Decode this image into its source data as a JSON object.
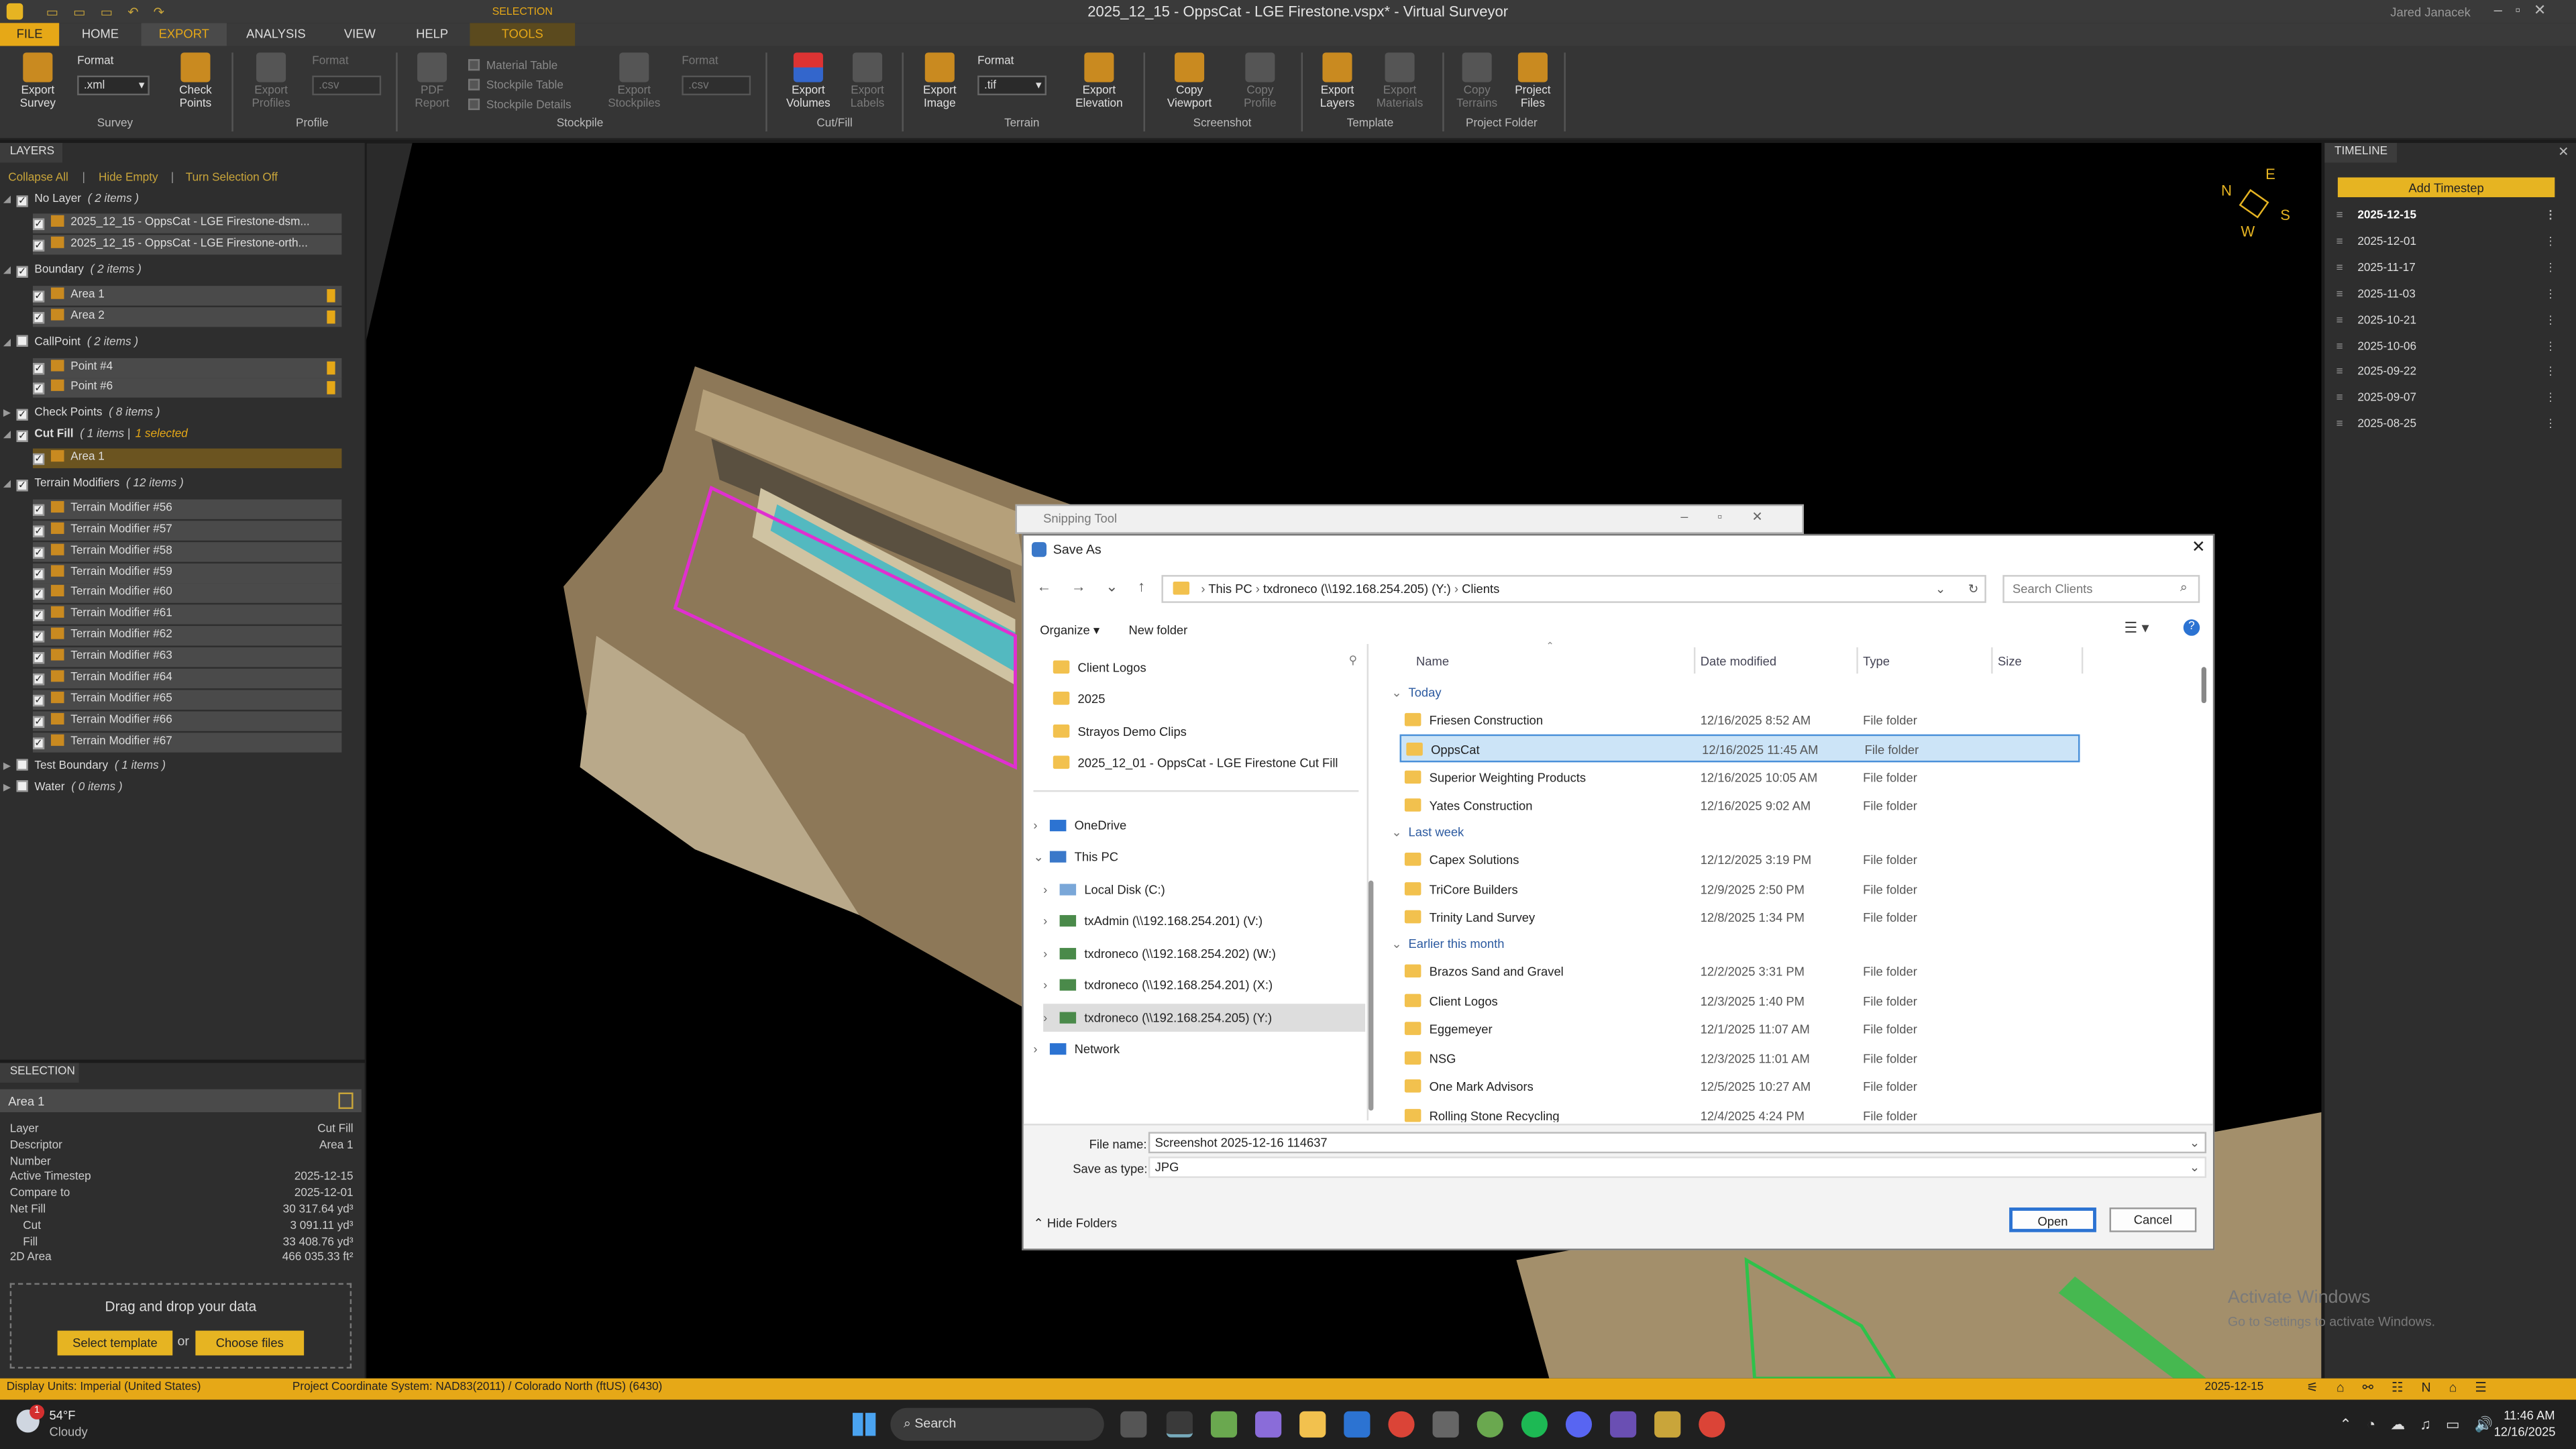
{
  "app": {
    "title": "2025_12_15 - OppsCat - LGE Firestone.vspx* - Virtual Surveyor",
    "user": "Jared Janacek",
    "selection_context": "SELECTION",
    "tools_tab": "TOOLS"
  },
  "tabs": [
    "FILE",
    "HOME",
    "EXPORT",
    "ANALYSIS",
    "VIEW",
    "HELP"
  ],
  "ribbon": {
    "survey": {
      "export_survey": "Export Survey",
      "format_label": "Format",
      "format_value": ".xml",
      "check_points": "Check Points",
      "group": "Survey"
    },
    "profile": {
      "export_profiles": "Export Profiles",
      "format_label": "Format",
      "format_value": ".csv",
      "group": "Profile"
    },
    "stockpile": {
      "pdf_report": "PDF Report",
      "material_table": "Material Table",
      "stockpile_table": "Stockpile Table",
      "stockpile_details": "Stockpile Details",
      "export_stockpiles": "Export Stockpiles",
      "format_label": "Format",
      "format_value": ".csv",
      "group": "Stockpile"
    },
    "cutfill": {
      "export_volumes": "Export Volumes",
      "export_labels": "Export Labels",
      "group": "Cut/Fill"
    },
    "terrain": {
      "export_image": "Export Image",
      "format_label": "Format",
      "format_value": ".tif",
      "export_elevation": "Export Elevation",
      "group": "Terrain"
    },
    "screenshot": {
      "copy_viewport": "Copy Viewport",
      "copy_profile": "Copy Profile",
      "group": "Screenshot"
    },
    "template": {
      "export_layers": "Export Layers",
      "export_materials": "Export Materials",
      "group": "Template"
    },
    "project_folder": {
      "copy_terrains": "Copy Terrains",
      "project_files": "Project Files",
      "group": "Project Folder"
    }
  },
  "layers": {
    "title": "LAYERS",
    "toolbar": {
      "collapse_all": "Collapse All",
      "hide_empty": "Hide Empty",
      "turn_off": "Turn Selection Off"
    },
    "items": [
      {
        "label": "No Layer",
        "sub": "( 2 items )",
        "level": 0
      },
      {
        "label": "2025_12_15 - OppsCat - LGE Firestone-dsm...",
        "level": 1
      },
      {
        "label": "2025_12_15 - OppsCat - LGE Firestone-orth...",
        "level": 1
      },
      {
        "label": "Boundary",
        "sub": "( 2 items )",
        "level": 0
      },
      {
        "label": "Area 1",
        "level": 1
      },
      {
        "label": "Area 2",
        "level": 1
      },
      {
        "label": "CallPoint",
        "sub": "( 2 items )",
        "level": 0
      },
      {
        "label": "Point #4",
        "level": 1
      },
      {
        "label": "Point #6",
        "level": 1
      },
      {
        "label": "Check Points",
        "sub": "( 8 items )",
        "level": 0
      },
      {
        "label": "Cut Fill",
        "sub": "( 1 items |",
        "sub2": "1 selected",
        "level": 0
      },
      {
        "label": "Area 1",
        "level": 1
      },
      {
        "label": "Terrain Modifiers",
        "sub": "( 12 items )",
        "level": 0
      },
      {
        "label": "Terrain Modifier #56",
        "level": 1
      },
      {
        "label": "Terrain Modifier #57",
        "level": 1
      },
      {
        "label": "Terrain Modifier #58",
        "level": 1
      },
      {
        "label": "Terrain Modifier #59",
        "level": 1
      },
      {
        "label": "Terrain Modifier #60",
        "level": 1
      },
      {
        "label": "Terrain Modifier #61",
        "level": 1
      },
      {
        "label": "Terrain Modifier #62",
        "level": 1
      },
      {
        "label": "Terrain Modifier #63",
        "level": 1
      },
      {
        "label": "Terrain Modifier #64",
        "level": 1
      },
      {
        "label": "Terrain Modifier #65",
        "level": 1
      },
      {
        "label": "Terrain Modifier #66",
        "level": 1
      },
      {
        "label": "Terrain Modifier #67",
        "level": 1
      },
      {
        "label": "Test Boundary",
        "sub": "( 1 items )",
        "level": 0
      },
      {
        "label": "Water",
        "sub": "( 0 items )",
        "level": 0
      }
    ]
  },
  "selection": {
    "title": "SELECTION",
    "name": "Area 1",
    "rows": [
      {
        "k": "Layer",
        "v": "Cut Fill"
      },
      {
        "k": "Descriptor",
        "v": "Area 1"
      },
      {
        "k": "Number",
        "v": ""
      },
      {
        "k": "Active Timestep",
        "v": "2025-12-15"
      },
      {
        "k": "Compare to",
        "v": "2025-12-01"
      },
      {
        "k": "Net Fill",
        "v": "30 317.64 yd³"
      },
      {
        "k": "Cut",
        "v": "3 091.11 yd³"
      },
      {
        "k": "Fill",
        "v": "33 408.76 yd³"
      },
      {
        "k": "2D Area",
        "v": "466 035.33 ft²"
      }
    ],
    "drop_text": "Drag and drop your data",
    "select_template": "Select template",
    "or": "or",
    "choose_files": "Choose files"
  },
  "timeline": {
    "title": "TIMELINE",
    "add": "Add Timestep",
    "dates": [
      "2025-12-15",
      "2025-12-01",
      "2025-11-17",
      "2025-11-03",
      "2025-10-21",
      "2025-10-06",
      "2025-09-22",
      "2025-09-07",
      "2025-08-25"
    ]
  },
  "compass": {
    "n": "N",
    "e": "E",
    "s": "S",
    "w": "W"
  },
  "snipping": {
    "title": "Snipping Tool"
  },
  "dialog": {
    "title": "Save As",
    "breadcrumb": [
      "This PC",
      "txdroneco (\\\\192.168.254.205) (Y:)",
      "Clients"
    ],
    "search_placeholder": "Search Clients",
    "organize": "Organize",
    "new_folder": "New folder",
    "nav_quick": [
      "Client Logos",
      "2025",
      "Strayos Demo Clips",
      "2025_12_01 - OppsCat - LGE Firestone Cut Fill"
    ],
    "nav_tree": [
      "OneDrive",
      "This PC",
      "Local Disk (C:)",
      "txAdmin (\\\\192.168.254.201) (V:)",
      "txdroneco (\\\\192.168.254.202) (W:)",
      "txdroneco (\\\\192.168.254.201) (X:)",
      "txdroneco (\\\\192.168.254.205) (Y:)",
      "Network"
    ],
    "columns": [
      "Name",
      "Date modified",
      "Type",
      "Size"
    ],
    "groups": [
      {
        "name": "Today",
        "files": [
          {
            "name": "Friesen Construction",
            "date": "12/16/2025 8:52 AM",
            "type": "File folder"
          },
          {
            "name": "OppsCat",
            "date": "12/16/2025 11:45 AM",
            "type": "File folder"
          },
          {
            "name": "Superior Weighting Products",
            "date": "12/16/2025 10:05 AM",
            "type": "File folder"
          },
          {
            "name": "Yates Construction",
            "date": "12/16/2025 9:02 AM",
            "type": "File folder"
          }
        ]
      },
      {
        "name": "Last week",
        "files": [
          {
            "name": "Capex Solutions",
            "date": "12/12/2025 3:19 PM",
            "type": "File folder"
          },
          {
            "name": "TriCore Builders",
            "date": "12/9/2025 2:50 PM",
            "type": "File folder"
          },
          {
            "name": "Trinity Land Survey",
            "date": "12/8/2025 1:34 PM",
            "type": "File folder"
          }
        ]
      },
      {
        "name": "Earlier this month",
        "files": [
          {
            "name": "Brazos Sand and Gravel",
            "date": "12/2/2025 3:31 PM",
            "type": "File folder"
          },
          {
            "name": "Client Logos",
            "date": "12/3/2025 1:40 PM",
            "type": "File folder"
          },
          {
            "name": "Eggemeyer",
            "date": "12/1/2025 11:07 AM",
            "type": "File folder"
          },
          {
            "name": "NSG",
            "date": "12/3/2025 11:01 AM",
            "type": "File folder"
          },
          {
            "name": "One Mark Advisors",
            "date": "12/5/2025 10:27 AM",
            "type": "File folder"
          },
          {
            "name": "Rolling Stone Recycling",
            "date": "12/4/2025 4:24 PM",
            "type": "File folder"
          }
        ]
      }
    ],
    "file_name_label": "File name:",
    "file_name": "Screenshot 2025-12-16 114637",
    "save_type_label": "Save as type:",
    "save_type": "JPG",
    "hide_folders": "Hide Folders",
    "open": "Open",
    "cancel": "Cancel"
  },
  "watermark": {
    "line1": "Activate Windows",
    "line2": "Go to Settings to activate Windows."
  },
  "status": {
    "units": "Display Units:  Imperial (United States)",
    "crs": "Project Coordinate System:  NAD83(2011) / Colorado North (ftUS) (6430)",
    "date": "2025-12-15"
  },
  "taskbar": {
    "temp": "54°F",
    "weather": "Cloudy",
    "search": "Search",
    "time": "11:46 AM",
    "date": "12/16/2025",
    "badge": "1"
  }
}
